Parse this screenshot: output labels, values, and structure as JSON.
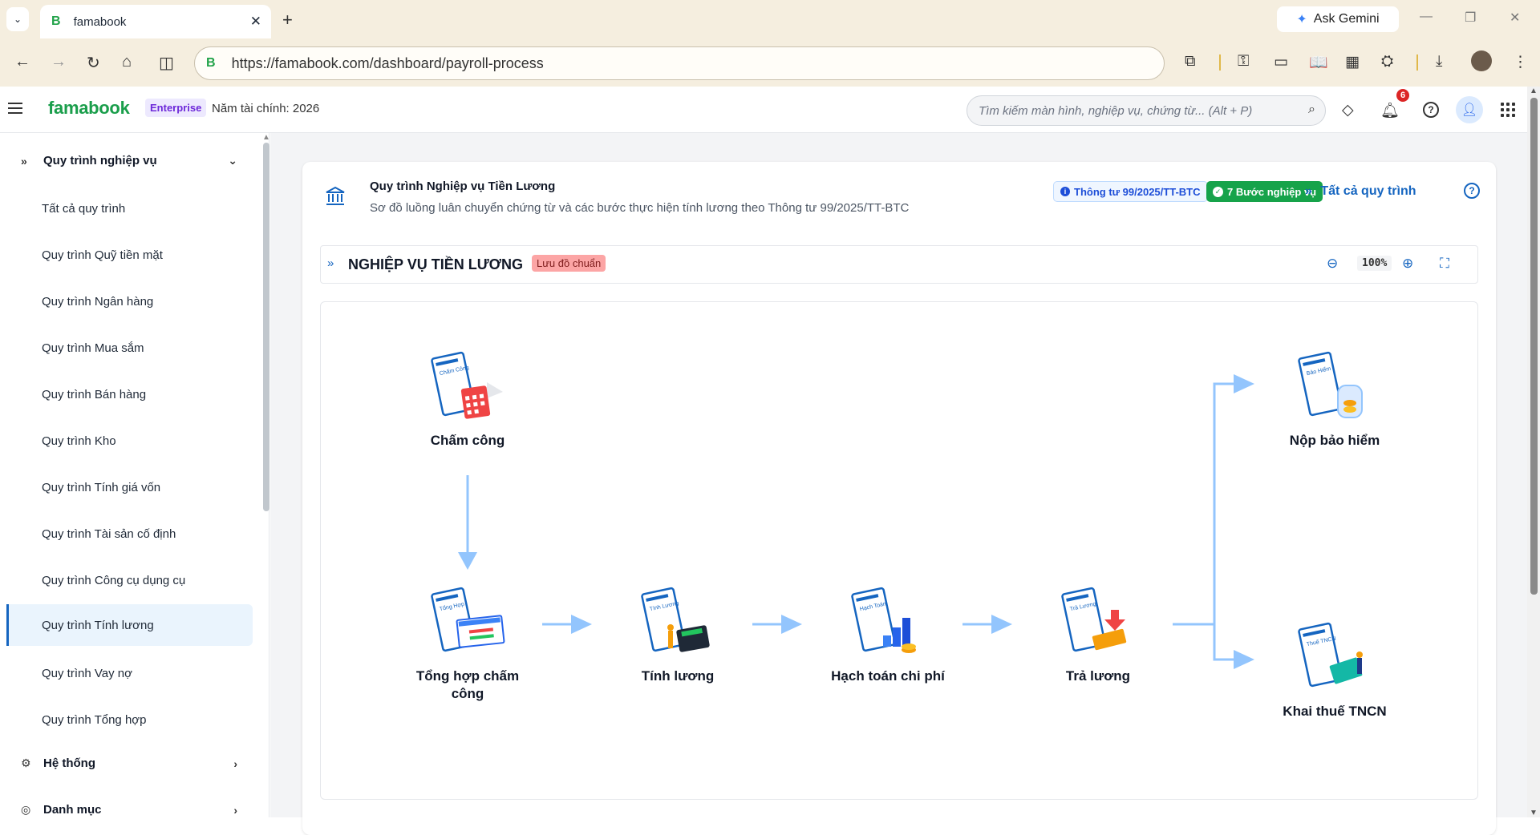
{
  "browser": {
    "tab_title": "famabook",
    "tab_favicon": "B",
    "url_favicon": "B",
    "url": "https://famabook.com/dashboard/payroll-process",
    "gemini_label": "Ask Gemini"
  },
  "header": {
    "logo": "famabook",
    "plan": "Enterprise",
    "fiscal_year": "Năm tài chính: 2026",
    "search_placeholder": "Tìm kiếm màn hình, nghiệp vụ, chứng từ... (Alt + P)",
    "notification_count": "6"
  },
  "sidebar": {
    "section_title": "Quy trình nghiệp vụ",
    "items": [
      {
        "label": "Tất cả quy trình"
      },
      {
        "label": "Quy trình Quỹ tiền mặt"
      },
      {
        "label": "Quy trình Ngân hàng"
      },
      {
        "label": "Quy trình Mua sắm"
      },
      {
        "label": "Quy trình Bán hàng"
      },
      {
        "label": "Quy trình Kho"
      },
      {
        "label": "Quy trình Tính giá vốn"
      },
      {
        "label": "Quy trình Tài sản cố định"
      },
      {
        "label": "Quy trình Công cụ dụng cụ"
      },
      {
        "label": "Quy trình Tính lương"
      },
      {
        "label": "Quy trình Vay nợ"
      },
      {
        "label": "Quy trình Tổng hợp"
      }
    ],
    "active_item": "Quy trình Tính lương",
    "system_label": "Hệ thống",
    "catalog_label": "Danh mục"
  },
  "card": {
    "title": "Quy trình Nghiệp vụ Tiền Lương",
    "subtitle": "Sơ đồ luồng luân chuyển chứng từ và các bước thực hiện tính lương theo Thông tư 99/2025/TT-BTC",
    "circular_tag": "Thông tư 99/2025/TT-BTC",
    "steps_tag": "7 Bước nghiệp vụ",
    "all_processes_link": "Tất cả quy trình"
  },
  "section": {
    "title": "NGHIỆP VỤ TIỀN LƯƠNG",
    "standard_tag": "Lưu đồ chuẩn",
    "zoom": "100%"
  },
  "diagram": {
    "nodes": [
      {
        "label": "Chấm công",
        "doc_text": "Chấm Công"
      },
      {
        "label": "Tổng hợp chấm công",
        "doc_text": "Tổng Hợp"
      },
      {
        "label": "Tính lương",
        "doc_text": "Tính Lương"
      },
      {
        "label": "Hạch toán chi phí",
        "doc_text": "Hạch Toán"
      },
      {
        "label": "Trả lương",
        "doc_text": "Trả Lương"
      },
      {
        "label": "Nộp bảo hiểm",
        "doc_text": "Bảo Hiểm"
      },
      {
        "label": "Khai thuế TNCN",
        "doc_text": "Thuế TNCN"
      }
    ],
    "accent_color": "#1565c0",
    "arrow_color": "#93c5fd"
  }
}
